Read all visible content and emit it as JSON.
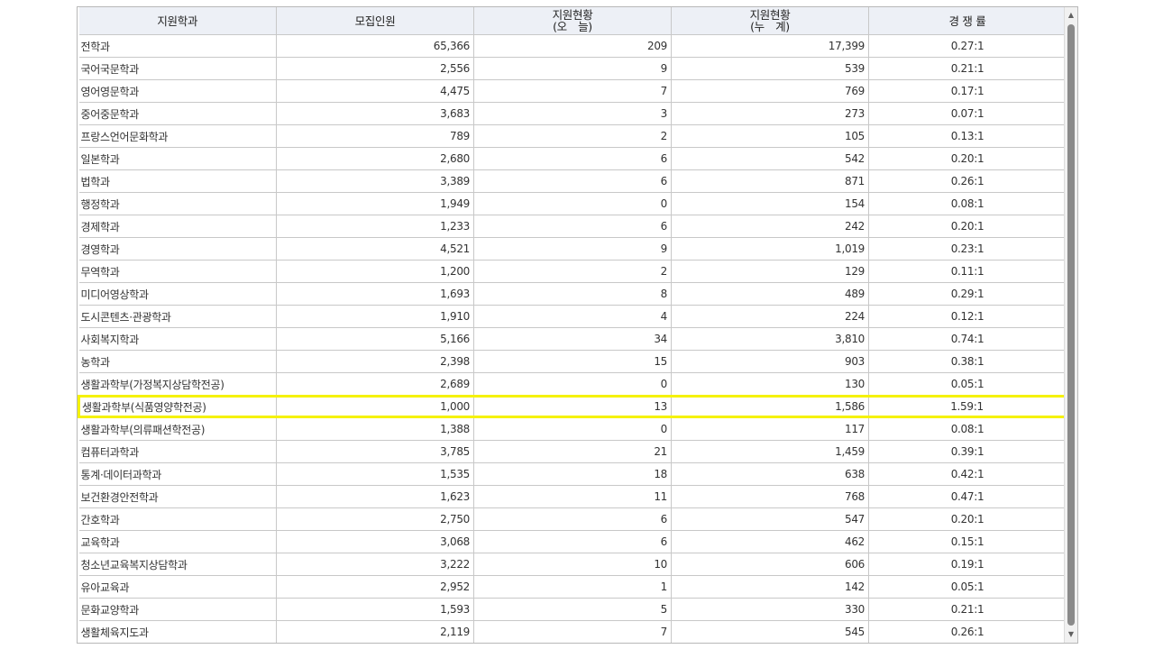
{
  "headers": {
    "dept": "지원학과",
    "quota": "모집인원",
    "today_line1": "지원현황",
    "today_line2": "(오　늘)",
    "total_line1": "지원현황",
    "total_line2": "(누　계)",
    "ratio": "경 쟁 률"
  },
  "rows": [
    {
      "dept": "전학과",
      "quota": "65,366",
      "today": "209",
      "total": "17,399",
      "ratio": "0.27:1"
    },
    {
      "dept": "국어국문학과",
      "quota": "2,556",
      "today": "9",
      "total": "539",
      "ratio": "0.21:1"
    },
    {
      "dept": "영어영문학과",
      "quota": "4,475",
      "today": "7",
      "total": "769",
      "ratio": "0.17:1"
    },
    {
      "dept": "중어중문학과",
      "quota": "3,683",
      "today": "3",
      "total": "273",
      "ratio": "0.07:1"
    },
    {
      "dept": "프랑스언어문화학과",
      "quota": "789",
      "today": "2",
      "total": "105",
      "ratio": "0.13:1"
    },
    {
      "dept": "일본학과",
      "quota": "2,680",
      "today": "6",
      "total": "542",
      "ratio": "0.20:1"
    },
    {
      "dept": "법학과",
      "quota": "3,389",
      "today": "6",
      "total": "871",
      "ratio": "0.26:1"
    },
    {
      "dept": "행정학과",
      "quota": "1,949",
      "today": "0",
      "total": "154",
      "ratio": "0.08:1"
    },
    {
      "dept": "경제학과",
      "quota": "1,233",
      "today": "6",
      "total": "242",
      "ratio": "0.20:1"
    },
    {
      "dept": "경영학과",
      "quota": "4,521",
      "today": "9",
      "total": "1,019",
      "ratio": "0.23:1"
    },
    {
      "dept": "무역학과",
      "quota": "1,200",
      "today": "2",
      "total": "129",
      "ratio": "0.11:1"
    },
    {
      "dept": "미디어영상학과",
      "quota": "1,693",
      "today": "8",
      "total": "489",
      "ratio": "0.29:1"
    },
    {
      "dept": "도시콘텐츠·관광학과",
      "quota": "1,910",
      "today": "4",
      "total": "224",
      "ratio": "0.12:1"
    },
    {
      "dept": "사회복지학과",
      "quota": "5,166",
      "today": "34",
      "total": "3,810",
      "ratio": "0.74:1"
    },
    {
      "dept": "농학과",
      "quota": "2,398",
      "today": "15",
      "total": "903",
      "ratio": "0.38:1"
    },
    {
      "dept": "생활과학부(가정복지상담학전공)",
      "quota": "2,689",
      "today": "0",
      "total": "130",
      "ratio": "0.05:1"
    },
    {
      "dept": "생활과학부(식품영양학전공)",
      "quota": "1,000",
      "today": "13",
      "total": "1,586",
      "ratio": "1.59:1",
      "highlight": true
    },
    {
      "dept": "생활과학부(의류패션학전공)",
      "quota": "1,388",
      "today": "0",
      "total": "117",
      "ratio": "0.08:1"
    },
    {
      "dept": "컴퓨터과학과",
      "quota": "3,785",
      "today": "21",
      "total": "1,459",
      "ratio": "0.39:1"
    },
    {
      "dept": "통계·데이터과학과",
      "quota": "1,535",
      "today": "18",
      "total": "638",
      "ratio": "0.42:1"
    },
    {
      "dept": "보건환경안전학과",
      "quota": "1,623",
      "today": "11",
      "total": "768",
      "ratio": "0.47:1"
    },
    {
      "dept": "간호학과",
      "quota": "2,750",
      "today": "6",
      "total": "547",
      "ratio": "0.20:1"
    },
    {
      "dept": "교육학과",
      "quota": "3,068",
      "today": "6",
      "total": "462",
      "ratio": "0.15:1"
    },
    {
      "dept": "청소년교육복지상담학과",
      "quota": "3,222",
      "today": "10",
      "total": "606",
      "ratio": "0.19:1"
    },
    {
      "dept": "유아교육과",
      "quota": "2,952",
      "today": "1",
      "total": "142",
      "ratio": "0.05:1"
    },
    {
      "dept": "문화교양학과",
      "quota": "1,593",
      "today": "5",
      "total": "330",
      "ratio": "0.21:1"
    },
    {
      "dept": "생활체육지도과",
      "quota": "2,119",
      "today": "7",
      "total": "545",
      "ratio": "0.26:1"
    }
  ],
  "colors": {
    "header_bg": "#edf0f6",
    "highlight": "#f5f200",
    "grid_line": "#c8c8c8"
  },
  "scrollbar": {
    "up_icon": "triangle-up",
    "down_icon": "triangle-down"
  }
}
